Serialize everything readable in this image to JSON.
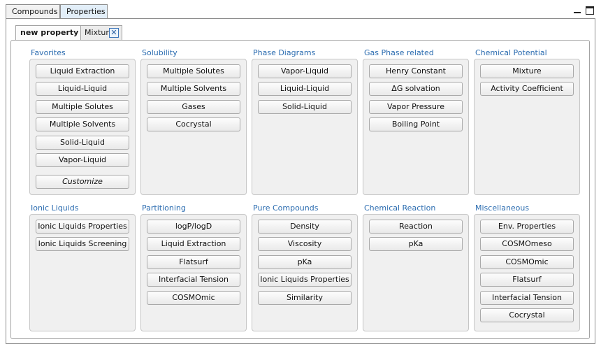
{
  "top_tabs": [
    "Compounds",
    "Properties"
  ],
  "sub_tabs": {
    "active": "new property",
    "second": "Mixture",
    "close_glyph": "✕"
  },
  "groups": {
    "favorites": {
      "title": "Favorites",
      "buttons": [
        "Liquid Extraction",
        "Liquid-Liquid",
        "Multiple Solutes",
        "Multiple Solvents",
        "Solid-Liquid",
        "Vapor-Liquid",
        "Customize"
      ]
    },
    "solubility": {
      "title": "Solubility",
      "buttons": [
        "Multiple Solutes",
        "Multiple Solvents",
        "Gases",
        "Cocrystal"
      ]
    },
    "phase_diagrams": {
      "title": "Phase Diagrams",
      "buttons": [
        "Vapor-Liquid",
        "Liquid-Liquid",
        "Solid-Liquid"
      ]
    },
    "gas_phase": {
      "title": "Gas Phase related",
      "buttons": [
        "Henry Constant",
        "ΔG solvation",
        "Vapor Pressure",
        "Boiling Point"
      ]
    },
    "chemical_potential": {
      "title": "Chemical Potential",
      "buttons": [
        "Mixture",
        "Activity Coefficient"
      ]
    },
    "ionic_liquids": {
      "title": "Ionic Liquids",
      "buttons": [
        "Ionic Liquids Properties",
        "Ionic Liquids Screening"
      ]
    },
    "partitioning": {
      "title": "Partitioning",
      "buttons": [
        "logP/logD",
        "Liquid Extraction",
        "Flatsurf",
        "Interfacial Tension",
        "COSMOmic"
      ]
    },
    "pure_compounds": {
      "title": "Pure Compounds",
      "buttons": [
        "Density",
        "Viscosity",
        "pKa",
        "Ionic Liquids Properties",
        "Similarity"
      ]
    },
    "chemical_reaction": {
      "title": "Chemical Reaction",
      "buttons": [
        "Reaction",
        "pKa"
      ]
    },
    "miscellaneous": {
      "title": "Miscellaneous",
      "buttons": [
        "Env. Properties",
        "COSMOmeso",
        "COSMOmic",
        "Flatsurf",
        "Interfacial Tension",
        "Cocrystal"
      ]
    }
  }
}
